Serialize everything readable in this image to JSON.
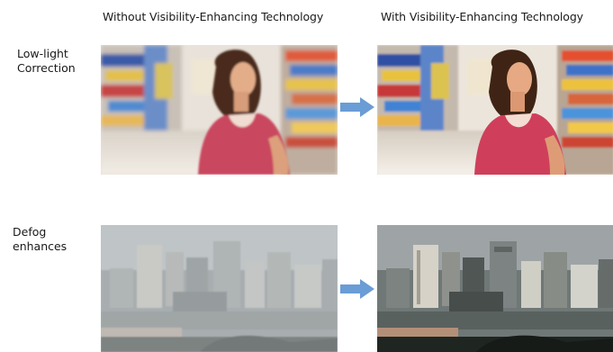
{
  "headers": {
    "without": "Without Visibility-Enhancing Technology",
    "with": "With Visibility-Enhancing Technology"
  },
  "rows": [
    {
      "label_line1": "Low-light",
      "label_line2": "Correction",
      "before_image": "woman-in-supermarket-aisle-photo-blurred",
      "after_image": "woman-in-supermarket-aisle-photo-corrected"
    },
    {
      "label_line1": "Defog",
      "label_line2": "enhances",
      "before_image": "hazy-city-skyline-photo",
      "after_image": "defogged-city-skyline-photo"
    }
  ],
  "colors": {
    "arrow": "#6a9cd6",
    "text": "#1a1a1a"
  },
  "icons": {
    "comparison_arrow": "right-arrow-icon"
  }
}
